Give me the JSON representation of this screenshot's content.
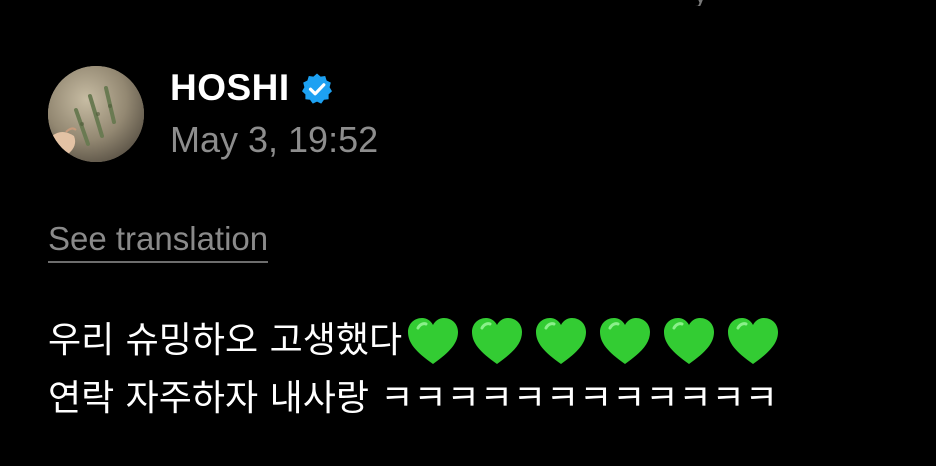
{
  "top_fragment": "y",
  "post": {
    "author": "HOSHI",
    "verified": true,
    "timestamp": "May 3, 19:52",
    "see_translation": "See translation",
    "line1_text": "우리 슈밍하오 고생했다",
    "hearts_count": 6,
    "heart_icon": "green-heart-icon",
    "line2_text": "연락 자주하자 내사랑 ㅋㅋㅋㅋㅋㅋㅋㅋㅋㅋㅋㅋ"
  },
  "colors": {
    "background": "#000000",
    "text": "#ffffff",
    "muted": "#8d8d8d",
    "verified": "#1da1f2",
    "heart": "#33cc33"
  }
}
